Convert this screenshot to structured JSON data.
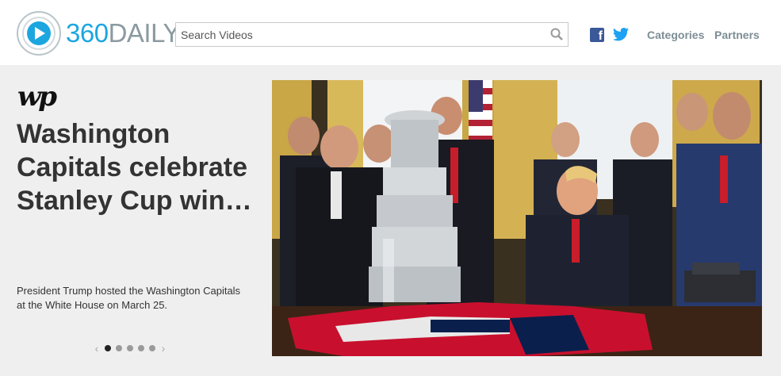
{
  "header": {
    "logo": {
      "number": "360",
      "word": "DAILY"
    },
    "search": {
      "placeholder": "Search Videos"
    },
    "social": {
      "facebook": "facebook-icon",
      "twitter": "twitter-icon"
    },
    "nav": {
      "categories": "Categories",
      "partners": "Partners"
    }
  },
  "feature": {
    "source_logo": "wp",
    "headline": "Washington Capitals celebrate Stanley Cup win…",
    "summary": "President Trump hosted the Washington Capitals at the White House on March 25.",
    "carousel": {
      "total": 5,
      "active": 1,
      "prev": "‹",
      "next": "›"
    }
  },
  "colors": {
    "brand_blue": "#1ba6e0",
    "brand_gray": "#8b9aa1",
    "nav_text": "#7d8d96",
    "page_bg": "#efefef"
  }
}
